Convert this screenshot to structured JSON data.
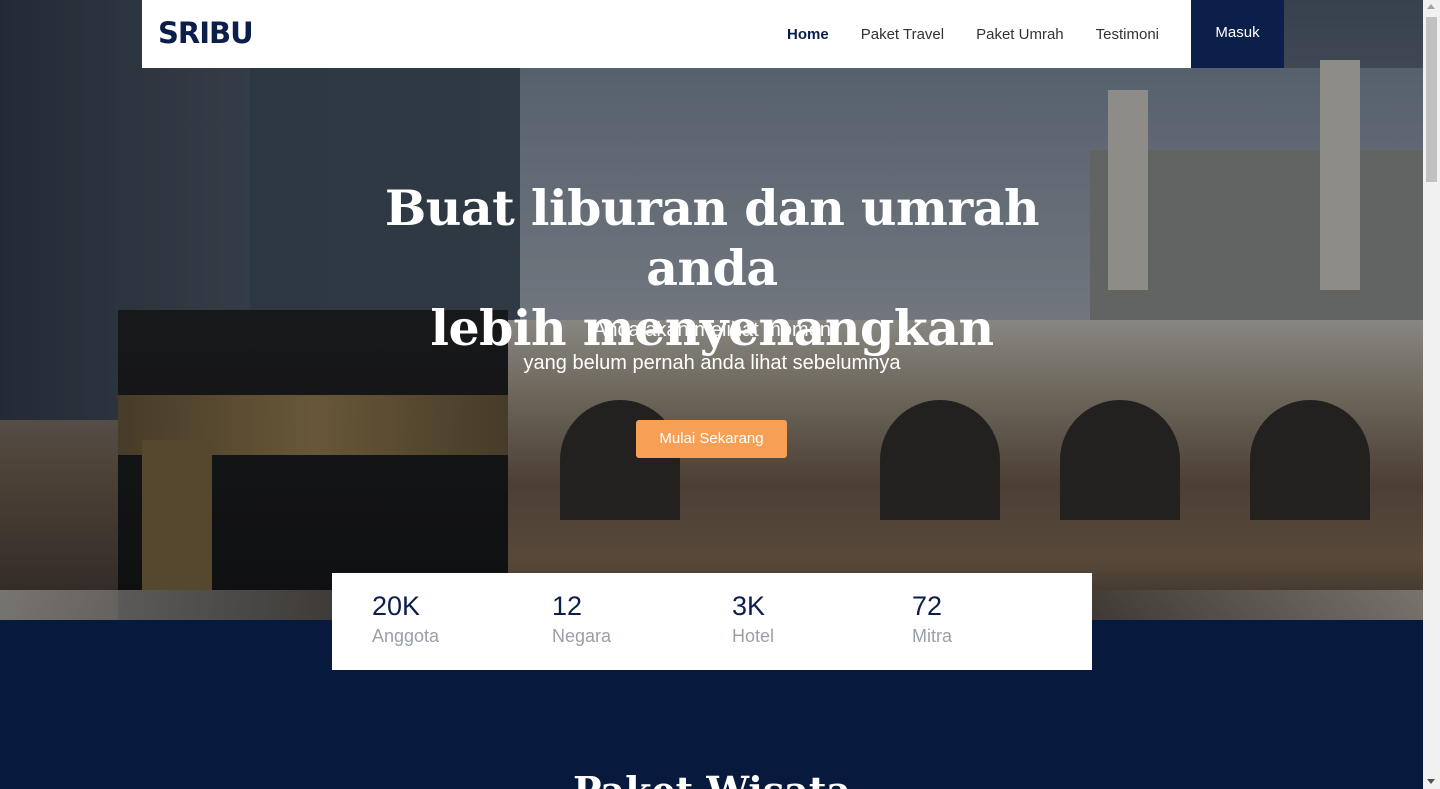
{
  "navbar": {
    "logo": "SRIBU",
    "links": [
      {
        "label": "Home",
        "active": true
      },
      {
        "label": "Paket Travel",
        "active": false
      },
      {
        "label": "Paket Umrah",
        "active": false
      },
      {
        "label": "Testimoni",
        "active": false
      }
    ],
    "login_label": "Masuk"
  },
  "hero": {
    "title_line1": "Buat liburan dan umrah anda",
    "title_line2": "lebih menyenangkan",
    "subtitle_line1": "Anda akan melihat momen",
    "subtitle_line2": "yang belum pernah anda lihat sebelumnya",
    "cta_label": "Mulai Sekarang"
  },
  "stats": [
    {
      "value": "20K",
      "label": "Anggota"
    },
    {
      "value": "12",
      "label": "Negara"
    },
    {
      "value": "3K",
      "label": "Hotel"
    },
    {
      "value": "72",
      "label": "Mitra"
    }
  ],
  "section": {
    "title": "Paket Wisata"
  },
  "colors": {
    "primary": "#0b1f4a",
    "accent": "#f6a055",
    "section_bg": "#071a3d"
  }
}
